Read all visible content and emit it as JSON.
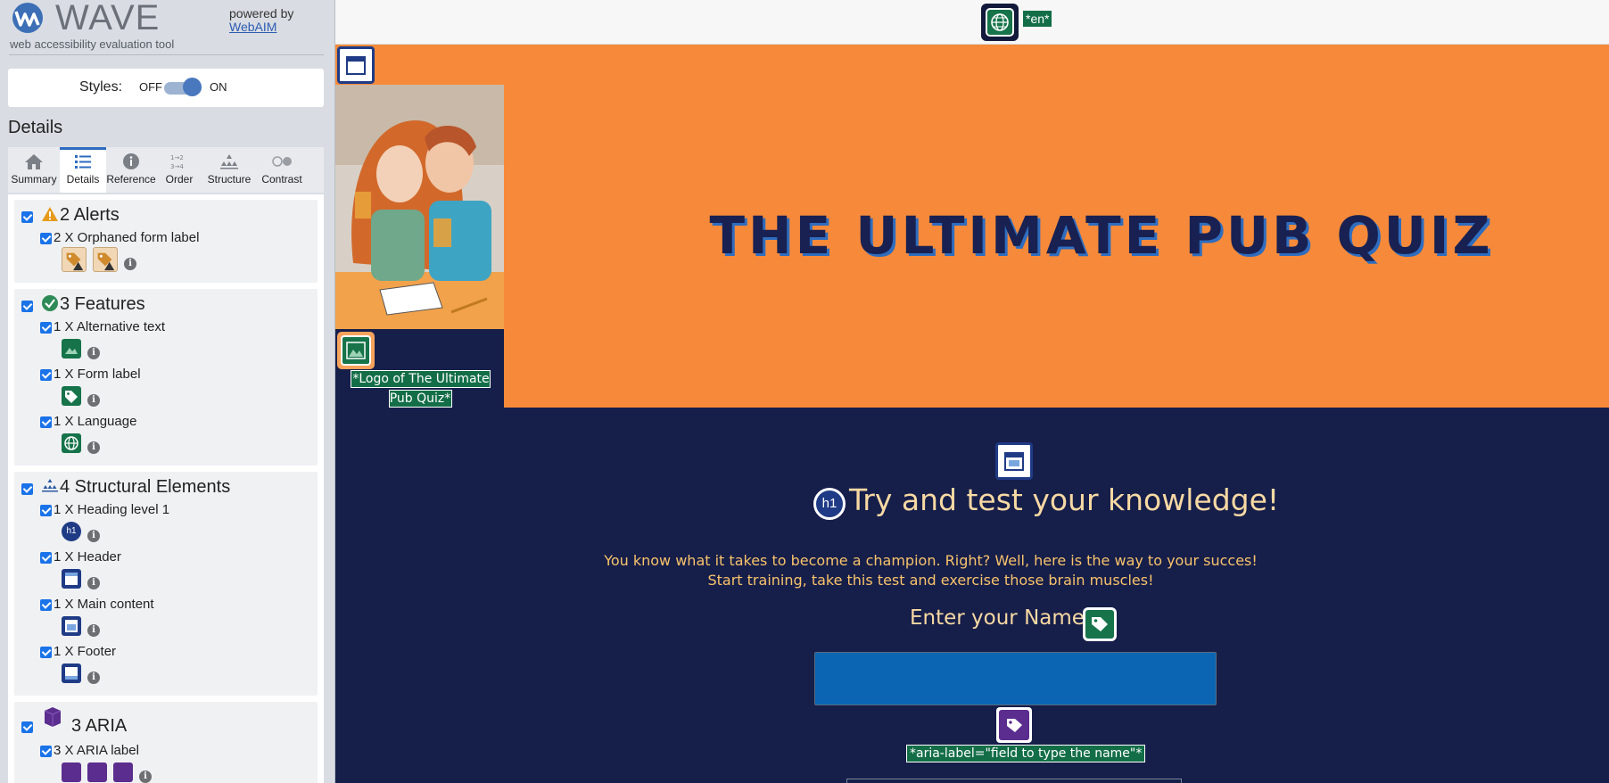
{
  "wave": {
    "brand": "WAVE",
    "tagline": "web accessibility evaluation tool",
    "powered_by": "powered by",
    "webaim_link": "WebAIM",
    "styles_label": "Styles:",
    "styles_off": "OFF",
    "styles_on": "ON",
    "details_title": "Details",
    "accent_color": "#2c6bbf"
  },
  "tabs": [
    {
      "label": "Summary",
      "icon": "home-icon"
    },
    {
      "label": "Details",
      "icon": "list-icon"
    },
    {
      "label": "Reference",
      "icon": "info-icon"
    },
    {
      "label": "Order",
      "icon": "order-icon"
    },
    {
      "label": "Structure",
      "icon": "structure-icon"
    },
    {
      "label": "Contrast",
      "icon": "contrast-icon"
    }
  ],
  "active_tab": "Details",
  "groups": {
    "alerts": {
      "title": "2 Alerts",
      "items": [
        {
          "label": "2 X Orphaned form label"
        }
      ]
    },
    "features": {
      "title": "3 Features",
      "items": [
        {
          "label": "1 X Alternative text"
        },
        {
          "label": "1 X Form label"
        },
        {
          "label": "1 X Language"
        }
      ]
    },
    "structure": {
      "title": "4 Structural Elements",
      "items": [
        {
          "label": "1 X Heading level 1"
        },
        {
          "label": "1 X Header"
        },
        {
          "label": "1 X Main content"
        },
        {
          "label": "1 X Footer"
        }
      ]
    },
    "aria": {
      "title": "3 ARIA",
      "items": [
        {
          "label": "3 X ARIA label"
        }
      ]
    }
  },
  "page": {
    "lang_tag": "*en*",
    "logo_caption": "*Logo of The Ultimate Pub Quiz*",
    "quiz_title": "THE ULTIMATE PUB QUIZ",
    "h1_badge": "h1",
    "main_heading": "Try and test your knowledge!",
    "intro_line1": "You know what it takes to become a champion. Right? Well, here is the way to your succes!",
    "intro_line2": "Start training, take this test and exercise those brain muscles!",
    "name_label": "Enter your Name",
    "aria_label_tag": "*aria-label=\"field to type the name\"*",
    "orange": "#f68a3a",
    "navy": "#161e4a"
  }
}
